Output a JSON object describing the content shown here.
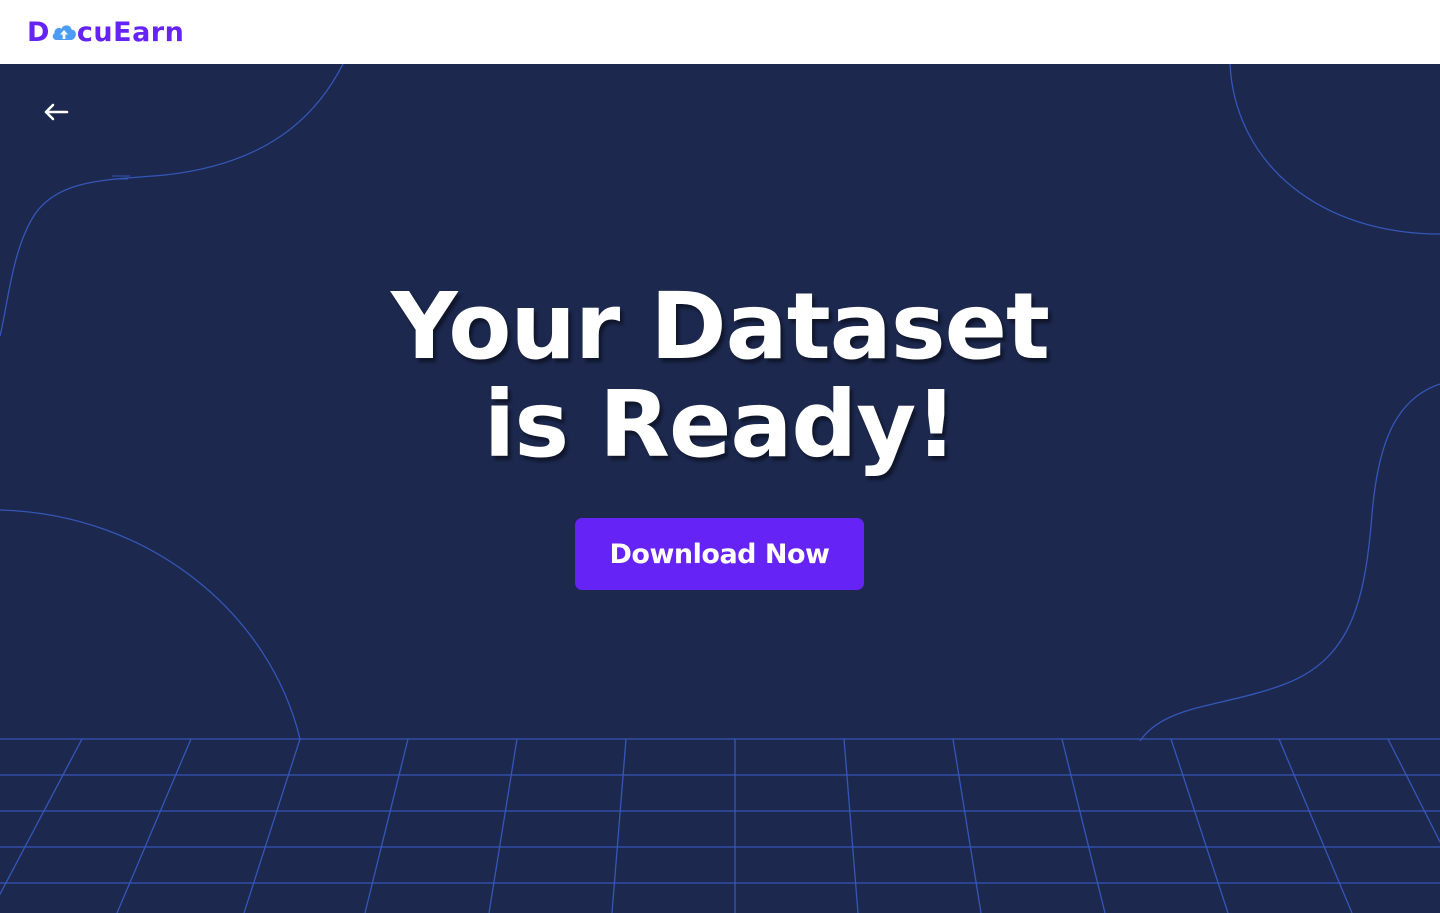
{
  "header": {
    "logo": {
      "text_before": "D",
      "text_after": "cuEarn",
      "icon": "cloud-upload-icon",
      "brand_color": "#6523f5",
      "icon_color": "#4a9cf5"
    }
  },
  "hero": {
    "back_icon": "arrow-left-icon",
    "headline_line1": "Your Dataset",
    "headline_line2": "is Ready!",
    "cta_label": "Download Now",
    "background_color": "#1c284e",
    "line_color": "#3556b8"
  }
}
